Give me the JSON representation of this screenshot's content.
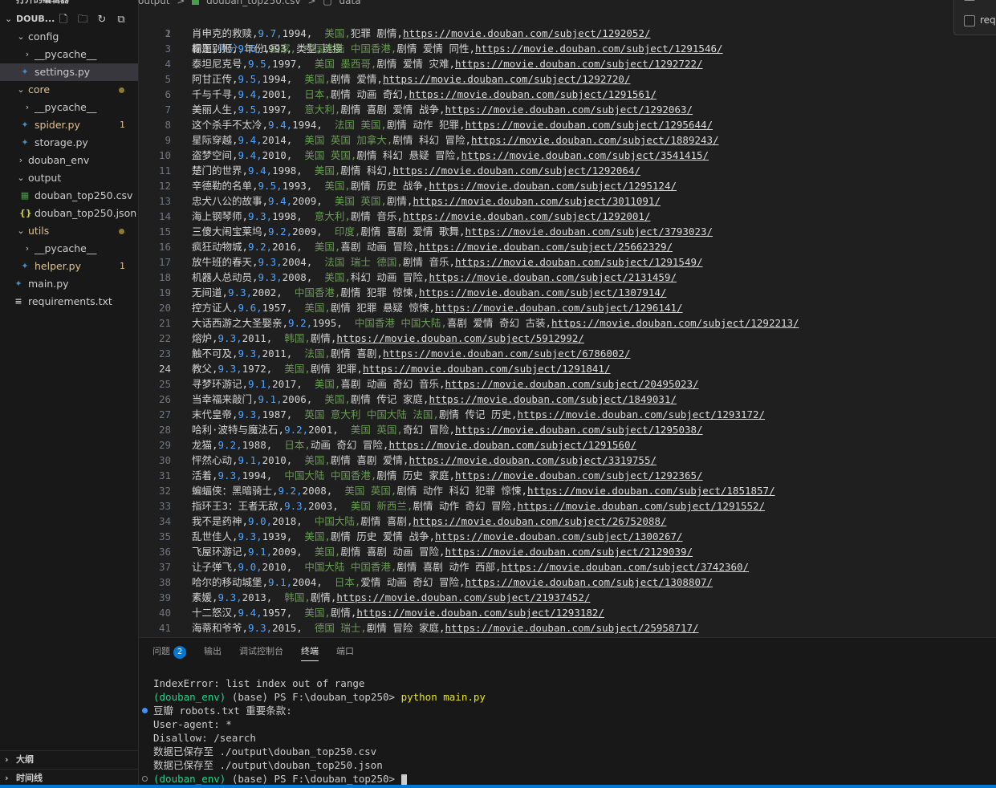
{
  "sidebar": {
    "open_editors_label": "打开的编辑器",
    "project_title": "DOUB...",
    "tree": [
      {
        "label": "config",
        "type": "folder",
        "expanded": true,
        "indent": 1
      },
      {
        "label": "__pycache__",
        "type": "folder",
        "expanded": false,
        "indent": 2
      },
      {
        "label": "settings.py",
        "type": "py",
        "indent": 2,
        "selected": true
      },
      {
        "label": "core",
        "type": "folder",
        "expanded": true,
        "indent": 1,
        "modified": true
      },
      {
        "label": "__pycache__",
        "type": "folder",
        "expanded": false,
        "indent": 2
      },
      {
        "label": "spider.py",
        "type": "py",
        "indent": 2,
        "problems": "1"
      },
      {
        "label": "storage.py",
        "type": "py",
        "indent": 2
      },
      {
        "label": "douban_env",
        "type": "folder",
        "expanded": false,
        "indent": 1
      },
      {
        "label": "output",
        "type": "folder",
        "expanded": true,
        "indent": 1
      },
      {
        "label": "douban_top250.csv",
        "type": "csv",
        "indent": 2
      },
      {
        "label": "douban_top250.json",
        "type": "json",
        "indent": 2
      },
      {
        "label": "utils",
        "type": "folder",
        "expanded": true,
        "indent": 1,
        "modified": true
      },
      {
        "label": "__pycache__",
        "type": "folder",
        "expanded": false,
        "indent": 2
      },
      {
        "label": "helper.py",
        "type": "py",
        "indent": 2,
        "problems": "1"
      },
      {
        "label": "main.py",
        "type": "py",
        "indent": 1
      },
      {
        "label": "requirements.txt",
        "type": "txt",
        "indent": 1
      }
    ],
    "outline_label": "大纲",
    "timeline_label": "时间线"
  },
  "breadcrumb": {
    "folder": "output",
    "sep": ">",
    "file": "douban_top250.csv",
    "section": "data"
  },
  "floating_widget": {
    "line2": "req"
  },
  "editor": {
    "active_line": 24,
    "header": {
      "a": "标题,",
      "b": "评分,",
      "c": "年份,",
      "d": "国家,",
      "e": "类型,链接"
    },
    "rows": [
      {
        "t": "肖申克的救赎,",
        "s": "9.7,",
        "y": "1994,",
        "c": "美国,",
        "g": "犯罪 剧情,",
        "u": "https://movie.douban.com/subject/1292052/"
      },
      {
        "t": "霸王别姬,",
        "s": "9.6,",
        "y": "1993,",
        "c": "中国大陆 中国香港,",
        "g": "剧情 爱情 同性,",
        "u": "https://movie.douban.com/subject/1291546/"
      },
      {
        "t": "泰坦尼克号,",
        "s": "9.5,",
        "y": "1997,",
        "c": "美国 墨西哥,",
        "g": "剧情 爱情 灾难,",
        "u": "https://movie.douban.com/subject/1292722/"
      },
      {
        "t": "阿甘正传,",
        "s": "9.5,",
        "y": "1994,",
        "c": "美国,",
        "g": "剧情 爱情,",
        "u": "https://movie.douban.com/subject/1292720/"
      },
      {
        "t": "千与千寻,",
        "s": "9.4,",
        "y": "2001,",
        "c": "日本,",
        "g": "剧情 动画 奇幻,",
        "u": "https://movie.douban.com/subject/1291561/"
      },
      {
        "t": "美丽人生,",
        "s": "9.5,",
        "y": "1997,",
        "c": "意大利,",
        "g": "剧情 喜剧 爱情 战争,",
        "u": "https://movie.douban.com/subject/1292063/"
      },
      {
        "t": "这个杀手不太冷,",
        "s": "9.4,",
        "y": "1994,",
        "c": "法国 美国,",
        "g": "剧情 动作 犯罪,",
        "u": "https://movie.douban.com/subject/1295644/"
      },
      {
        "t": "星际穿越,",
        "s": "9.4,",
        "y": "2014,",
        "c": "美国 英国 加拿大,",
        "g": "剧情 科幻 冒险,",
        "u": "https://movie.douban.com/subject/1889243/"
      },
      {
        "t": "盗梦空间,",
        "s": "9.4,",
        "y": "2010,",
        "c": "美国 英国,",
        "g": "剧情 科幻 悬疑 冒险,",
        "u": "https://movie.douban.com/subject/3541415/"
      },
      {
        "t": "楚门的世界,",
        "s": "9.4,",
        "y": "1998,",
        "c": "美国,",
        "g": "剧情 科幻,",
        "u": "https://movie.douban.com/subject/1292064/"
      },
      {
        "t": "辛德勒的名单,",
        "s": "9.5,",
        "y": "1993,",
        "c": "美国,",
        "g": "剧情 历史 战争,",
        "u": "https://movie.douban.com/subject/1295124/"
      },
      {
        "t": "忠犬八公的故事,",
        "s": "9.4,",
        "y": "2009,",
        "c": "美国 英国,",
        "g": "剧情,",
        "u": "https://movie.douban.com/subject/3011091/"
      },
      {
        "t": "海上钢琴师,",
        "s": "9.3,",
        "y": "1998,",
        "c": "意大利,",
        "g": "剧情 音乐,",
        "u": "https://movie.douban.com/subject/1292001/"
      },
      {
        "t": "三傻大闹宝莱坞,",
        "s": "9.2,",
        "y": "2009,",
        "c": "印度,",
        "g": "剧情 喜剧 爱情 歌舞,",
        "u": "https://movie.douban.com/subject/3793023/"
      },
      {
        "t": "疯狂动物城,",
        "s": "9.2,",
        "y": "2016,",
        "c": "美国,",
        "g": "喜剧 动画 冒险,",
        "u": "https://movie.douban.com/subject/25662329/"
      },
      {
        "t": "放牛班的春天,",
        "s": "9.3,",
        "y": "2004,",
        "c": "法国 瑞士 德国,",
        "g": "剧情 音乐,",
        "u": "https://movie.douban.com/subject/1291549/"
      },
      {
        "t": "机器人总动员,",
        "s": "9.3,",
        "y": "2008,",
        "c": "美国,",
        "g": "科幻 动画 冒险,",
        "u": "https://movie.douban.com/subject/2131459/"
      },
      {
        "t": "无间道,",
        "s": "9.3,",
        "y": "2002,",
        "c": "中国香港,",
        "g": "剧情 犯罪 惊悚,",
        "u": "https://movie.douban.com/subject/1307914/"
      },
      {
        "t": "控方证人,",
        "s": "9.6,",
        "y": "1957,",
        "c": "美国,",
        "g": "剧情 犯罪 悬疑 惊悚,",
        "u": "https://movie.douban.com/subject/1296141/"
      },
      {
        "t": "大话西游之大圣娶亲,",
        "s": "9.2,",
        "y": "1995,",
        "c": "中国香港 中国大陆,",
        "g": "喜剧 爱情 奇幻 古装,",
        "u": "https://movie.douban.com/subject/1292213/"
      },
      {
        "t": "熔炉,",
        "s": "9.3,",
        "y": "2011,",
        "c": "韩国,",
        "g": "剧情,",
        "u": "https://movie.douban.com/subject/5912992/"
      },
      {
        "t": "触不可及,",
        "s": "9.3,",
        "y": "2011,",
        "c": "法国,",
        "g": "剧情 喜剧,",
        "u": "https://movie.douban.com/subject/6786002/"
      },
      {
        "t": "教父,",
        "s": "9.3,",
        "y": "1972,",
        "c": "美国,",
        "g": "剧情 犯罪,",
        "u": "https://movie.douban.com/subject/1291841/"
      },
      {
        "t": "寻梦环游记,",
        "s": "9.1,",
        "y": "2017,",
        "c": "美国,",
        "g": "喜剧 动画 奇幻 音乐,",
        "u": "https://movie.douban.com/subject/20495023/"
      },
      {
        "t": "当幸福来敲门,",
        "s": "9.1,",
        "y": "2006,",
        "c": "美国,",
        "g": "剧情 传记 家庭,",
        "u": "https://movie.douban.com/subject/1849031/"
      },
      {
        "t": "末代皇帝,",
        "s": "9.3,",
        "y": "1987,",
        "c": "英国 意大利 中国大陆 法国,",
        "g": "剧情 传记 历史,",
        "u": "https://movie.douban.com/subject/1293172/"
      },
      {
        "t": "哈利·波特与魔法石,",
        "s": "9.2,",
        "y": "2001,",
        "c": "美国 英国,",
        "g": "奇幻 冒险,",
        "u": "https://movie.douban.com/subject/1295038/"
      },
      {
        "t": "龙猫,",
        "s": "9.2,",
        "y": "1988,",
        "c": "日本,",
        "g": "动画 奇幻 冒险,",
        "u": "https://movie.douban.com/subject/1291560/"
      },
      {
        "t": "怦然心动,",
        "s": "9.1,",
        "y": "2010,",
        "c": "美国,",
        "g": "剧情 喜剧 爱情,",
        "u": "https://movie.douban.com/subject/3319755/"
      },
      {
        "t": "活着,",
        "s": "9.3,",
        "y": "1994,",
        "c": "中国大陆 中国香港,",
        "g": "剧情 历史 家庭,",
        "u": "https://movie.douban.com/subject/1292365/"
      },
      {
        "t": "蝙蝠侠：黑暗骑士,",
        "s": "9.2,",
        "y": "2008,",
        "c": "美国 英国,",
        "g": "剧情 动作 科幻 犯罪 惊悚,",
        "u": "https://movie.douban.com/subject/1851857/"
      },
      {
        "t": "指环王3：王者无敌,",
        "s": "9.3,",
        "y": "2003,",
        "c": "美国 新西兰,",
        "g": "剧情 动作 奇幻 冒险,",
        "u": "https://movie.douban.com/subject/1291552/"
      },
      {
        "t": "我不是药神,",
        "s": "9.0,",
        "y": "2018,",
        "c": "中国大陆,",
        "g": "剧情 喜剧,",
        "u": "https://movie.douban.com/subject/26752088/"
      },
      {
        "t": "乱世佳人,",
        "s": "9.3,",
        "y": "1939,",
        "c": "美国,",
        "g": "剧情 历史 爱情 战争,",
        "u": "https://movie.douban.com/subject/1300267/"
      },
      {
        "t": "飞屋环游记,",
        "s": "9.1,",
        "y": "2009,",
        "c": "美国,",
        "g": "剧情 喜剧 动画 冒险,",
        "u": "https://movie.douban.com/subject/2129039/"
      },
      {
        "t": "让子弹飞,",
        "s": "9.0,",
        "y": "2010,",
        "c": "中国大陆 中国香港,",
        "g": "剧情 喜剧 动作 西部,",
        "u": "https://movie.douban.com/subject/3742360/"
      },
      {
        "t": "哈尔的移动城堡,",
        "s": "9.1,",
        "y": "2004,",
        "c": "日本,",
        "g": "爱情 动画 奇幻 冒险,",
        "u": "https://movie.douban.com/subject/1308807/"
      },
      {
        "t": "素媛,",
        "s": "9.3,",
        "y": "2013,",
        "c": "韩国,",
        "g": "剧情,",
        "u": "https://movie.douban.com/subject/21937452/"
      },
      {
        "t": "十二怒汉,",
        "s": "9.4,",
        "y": "1957,",
        "c": "美国,",
        "g": "剧情,",
        "u": "https://movie.douban.com/subject/1293182/"
      },
      {
        "t": "海蒂和爷爷,",
        "s": "9.3,",
        "y": "2015,",
        "c": "德国 瑞士,",
        "g": "剧情 冒险 家庭,",
        "u": "https://movie.douban.com/subject/25958717/"
      }
    ]
  },
  "panel": {
    "tabs": [
      {
        "label": "问题",
        "badge": "2"
      },
      {
        "label": "输出"
      },
      {
        "label": "调试控制台"
      },
      {
        "label": "终端",
        "active": true
      },
      {
        "label": "端口"
      }
    ],
    "terminal": {
      "error_line": "IndexError: list index out of range",
      "env": "(douban_env)",
      "prompt": " (base) PS F:\\douban_top250> ",
      "command": "python main.py",
      "output": [
        "豆瓣 robots.txt 重要条款:",
        "User-agent: *",
        "Disallow: /search",
        "数据已保存至 ./output\\douban_top250.csv",
        "数据已保存至 ./output\\douban_top250.json"
      ],
      "final_prompt": " (base) PS F:\\douban_top250>"
    }
  }
}
